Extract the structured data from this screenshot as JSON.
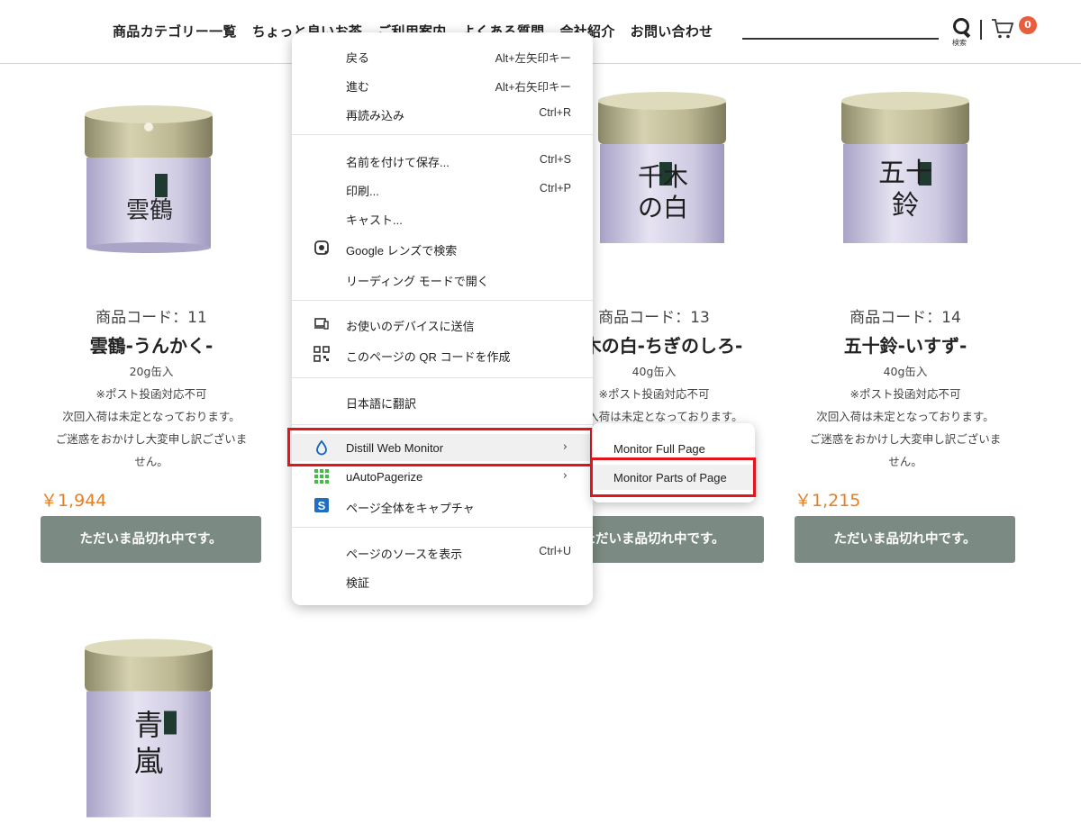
{
  "nav": [
    "商品カテゴリー一覧",
    "ちょっと良いお茶",
    "ご利用案内",
    "よくある質問",
    "会社紹介",
    "お問い合わせ"
  ],
  "header": {
    "search_caption": "検索",
    "cart_count": "0"
  },
  "products": [
    {
      "code": "商品コード：11",
      "name": "雲鶴-うんかく-",
      "size": "20g缶入",
      "post": "※ポスト投函対応不可",
      "restock": "次回入荷は未定となっております。",
      "apology1": "ご迷惑をおかけし大変申し訳ございま",
      "apology2": "せん。",
      "price": "￥1,944",
      "status": "ただいま品切れ中です。",
      "can_text": "雲鶴"
    },
    {
      "code": "商品コード：13",
      "name": "千木の白-ちぎのしろ-",
      "size": "40g缶入",
      "post": "※ポスト投函対応不可",
      "restock": "次回入荷は未定となっております。",
      "status": "ただいま品切れ中です。",
      "can_text": "千木の白"
    },
    {
      "code": "商品コード：14",
      "name": "五十鈴-いすず-",
      "size": "40g缶入",
      "post": "※ポスト投函対応不可",
      "restock": "次回入荷は未定となっております。",
      "apology1": "ご迷惑をおかけし大変申し訳ございま",
      "apology2": "せん。",
      "price": "￥1,215",
      "status": "ただいま品切れ中です。",
      "can_text": "五十鈴"
    },
    {
      "can_text": "青嵐"
    }
  ],
  "context_menu": {
    "items": [
      {
        "label": "戻る",
        "shortcut": "Alt+左矢印キー"
      },
      {
        "label": "進む",
        "shortcut": "Alt+右矢印キー"
      },
      {
        "label": "再読み込み",
        "shortcut": "Ctrl+R"
      },
      {
        "label": "名前を付けて保存...",
        "shortcut": "Ctrl+S"
      },
      {
        "label": "印刷...",
        "shortcut": "Ctrl+P"
      },
      {
        "label": "キャスト..."
      },
      {
        "label": "Google レンズで検索",
        "icon": "google-lens-icon"
      },
      {
        "label": "リーディング モードで開く"
      },
      {
        "label": "お使いのデバイスに送信",
        "icon": "devices-icon"
      },
      {
        "label": "このページの QR コードを作成",
        "icon": "qr-code-icon"
      },
      {
        "label": "日本語に翻訳"
      },
      {
        "label": "Distill Web Monitor",
        "icon": "distill-drop-icon"
      },
      {
        "label": "uAutoPagerize",
        "icon": "grid-icon"
      },
      {
        "label": "ページ全体をキャプチャ",
        "icon": "capture-icon"
      },
      {
        "label": "ページのソースを表示",
        "shortcut": "Ctrl+U"
      },
      {
        "label": "検証"
      }
    ],
    "submenu": [
      "Monitor Full Page",
      "Monitor Parts of Page"
    ]
  },
  "colors": {
    "accent_price": "#e67e22",
    "soldout_button": "#7b8a82",
    "highlight_box": "#e3151c",
    "cart_badge": "#e85d3c"
  }
}
